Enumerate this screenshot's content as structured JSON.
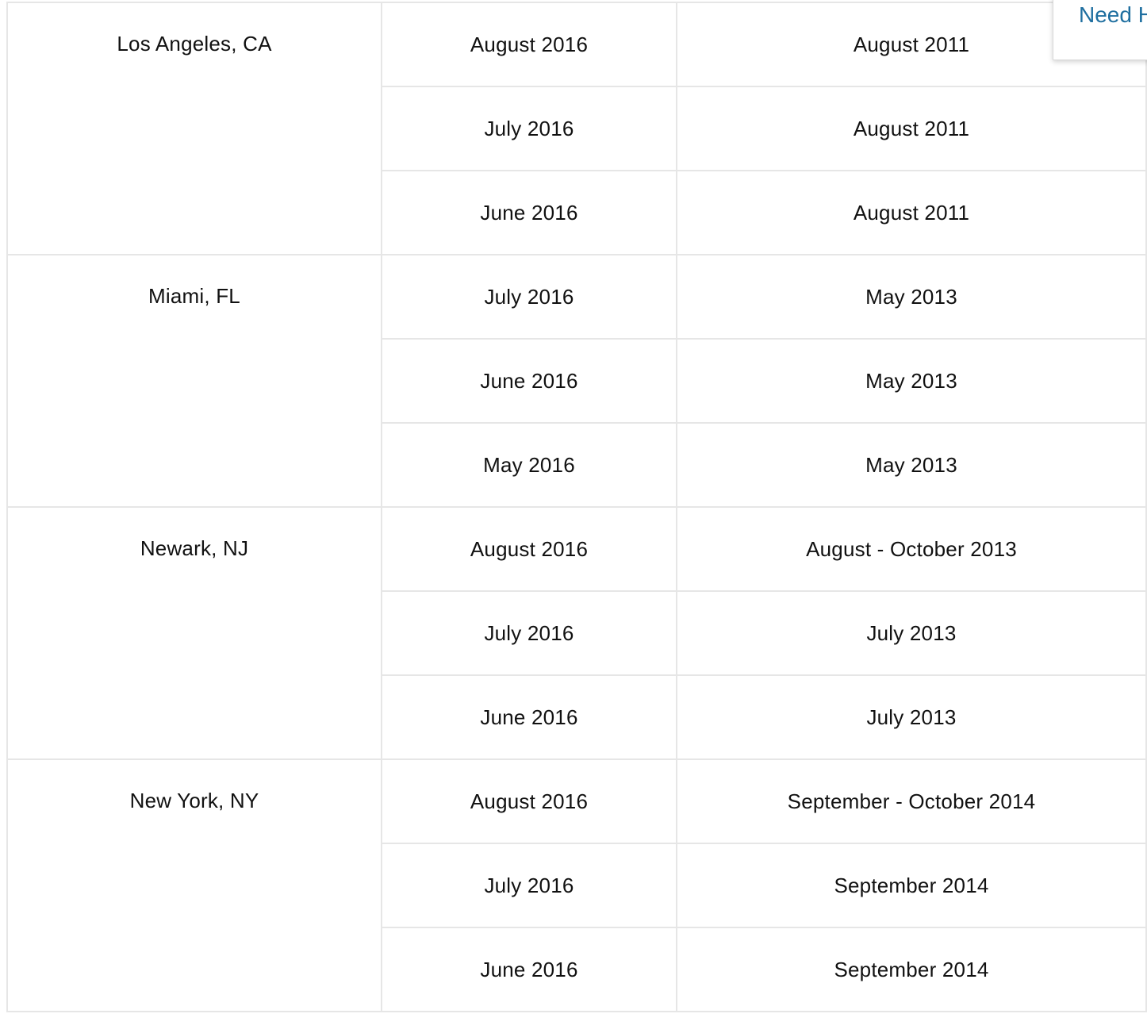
{
  "help_tab": {
    "label": "Need Help?"
  },
  "table": {
    "groups": [
      {
        "city": "Los Angeles, CA",
        "rows": [
          {
            "a": "August 2016",
            "b": "August 2011"
          },
          {
            "a": "July 2016",
            "b": "August 2011"
          },
          {
            "a": "June 2016",
            "b": "August 2011"
          }
        ]
      },
      {
        "city": "Miami, FL",
        "rows": [
          {
            "a": "July 2016",
            "b": "May 2013"
          },
          {
            "a": "June 2016",
            "b": "May 2013"
          },
          {
            "a": "May 2016",
            "b": "May 2013"
          }
        ]
      },
      {
        "city": "Newark, NJ",
        "rows": [
          {
            "a": "August 2016",
            "b": "August - October 2013"
          },
          {
            "a": "July 2016",
            "b": "July 2013"
          },
          {
            "a": "June 2016",
            "b": "July 2013"
          }
        ]
      },
      {
        "city": "New York, NY",
        "rows": [
          {
            "a": "August 2016",
            "b": "September - October 2014"
          },
          {
            "a": "July 2016",
            "b": "September 2014"
          },
          {
            "a": "June  2016",
            "b": "September 2014"
          }
        ]
      }
    ]
  }
}
